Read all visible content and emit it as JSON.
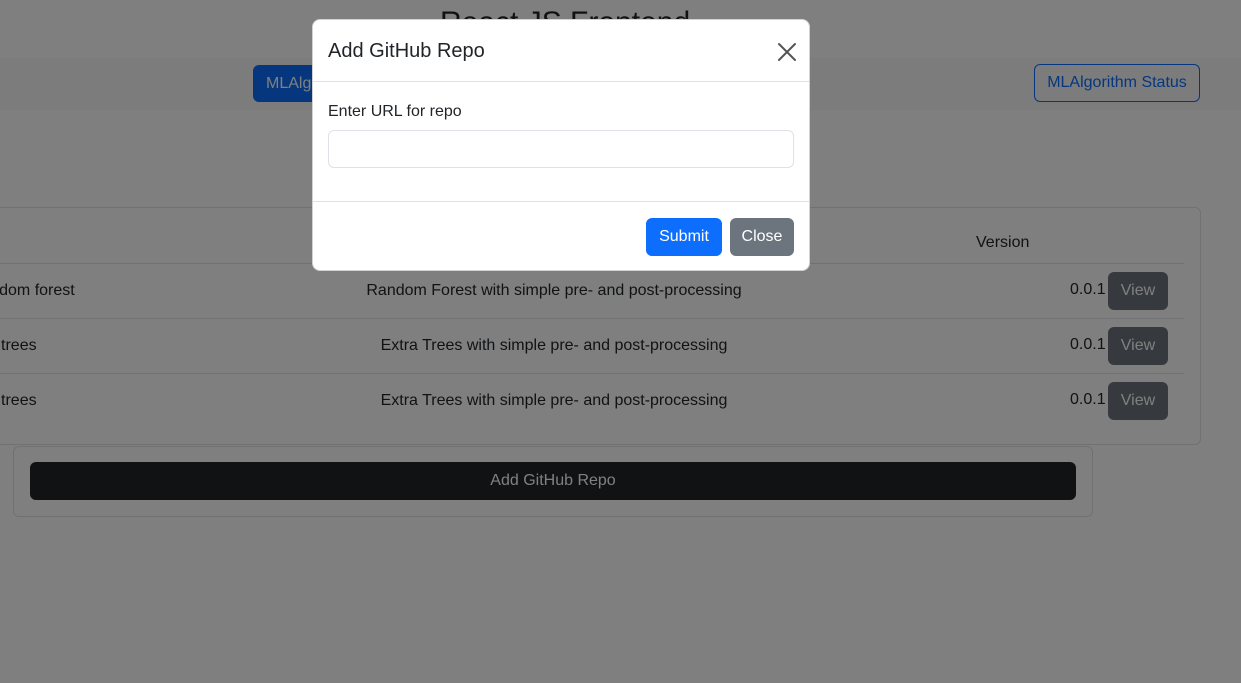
{
  "app": {
    "title": "React JS Frontend"
  },
  "nav": {
    "algorithms_button": "MLAlgorithms",
    "status_button": "MLAlgorithm Status"
  },
  "table": {
    "version_header": "Version",
    "rows": [
      {
        "name": "random forest",
        "description": "Random Forest with simple pre- and post-processing",
        "version": "0.0.1",
        "action": "View"
      },
      {
        "name": "extra trees",
        "description": "Extra Trees with simple pre- and post-processing",
        "version": "0.0.1",
        "action": "View"
      },
      {
        "name": "extra trees",
        "description": "Extra Trees with simple pre- and post-processing",
        "version": "0.0.1",
        "action": "View"
      }
    ]
  },
  "add_repo_button": "Add GitHub Repo",
  "modal": {
    "title": "Add GitHub Repo",
    "field_label": "Enter URL for repo",
    "url_value": "",
    "submit_label": "Submit",
    "close_label": "Close",
    "close_icon": "close-icon"
  }
}
